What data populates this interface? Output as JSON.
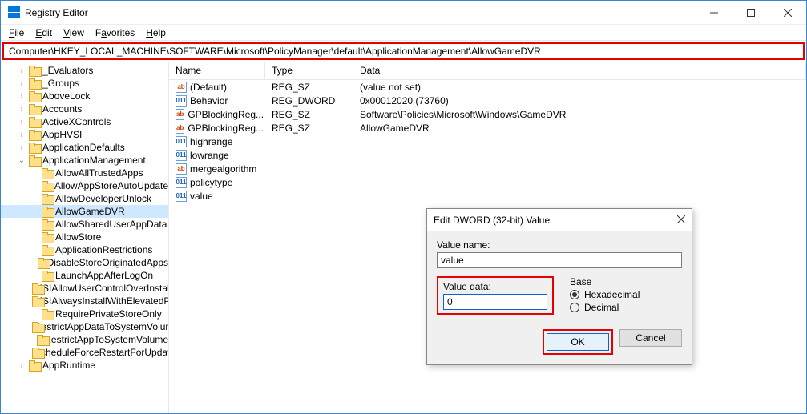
{
  "title": "Registry Editor",
  "window_controls": {
    "min": "minimize",
    "max": "maximize",
    "close": "close"
  },
  "menu": {
    "file": "File",
    "edit": "Edit",
    "view": "View",
    "favorites": "Favorites",
    "help": "Help"
  },
  "address": "Computer\\HKEY_LOCAL_MACHINE\\SOFTWARE\\Microsoft\\PolicyManager\\default\\ApplicationManagement\\AllowGameDVR",
  "tree": [
    {
      "label": "_Evaluators",
      "indent": 1,
      "exp": ">"
    },
    {
      "label": "_Groups",
      "indent": 1,
      "exp": ">"
    },
    {
      "label": "AboveLock",
      "indent": 1,
      "exp": ">"
    },
    {
      "label": "Accounts",
      "indent": 1,
      "exp": ">"
    },
    {
      "label": "ActiveXControls",
      "indent": 1,
      "exp": ">"
    },
    {
      "label": "AppHVSI",
      "indent": 1,
      "exp": ">"
    },
    {
      "label": "ApplicationDefaults",
      "indent": 1,
      "exp": ">"
    },
    {
      "label": "ApplicationManagement",
      "indent": 1,
      "exp": "v"
    },
    {
      "label": "AllowAllTrustedApps",
      "indent": 2,
      "exp": ""
    },
    {
      "label": "AllowAppStoreAutoUpdate",
      "indent": 2,
      "exp": ""
    },
    {
      "label": "AllowDeveloperUnlock",
      "indent": 2,
      "exp": ""
    },
    {
      "label": "AllowGameDVR",
      "indent": 2,
      "exp": "",
      "selected": true
    },
    {
      "label": "AllowSharedUserAppData",
      "indent": 2,
      "exp": ""
    },
    {
      "label": "AllowStore",
      "indent": 2,
      "exp": ""
    },
    {
      "label": "ApplicationRestrictions",
      "indent": 2,
      "exp": ""
    },
    {
      "label": "DisableStoreOriginatedApps",
      "indent": 2,
      "exp": ""
    },
    {
      "label": "LaunchAppAfterLogOn",
      "indent": 2,
      "exp": ""
    },
    {
      "label": "MSIAllowUserControlOverInstall",
      "indent": 2,
      "exp": ""
    },
    {
      "label": "MSIAlwaysInstallWithElevatedPrivileges",
      "indent": 2,
      "exp": ""
    },
    {
      "label": "RequirePrivateStoreOnly",
      "indent": 2,
      "exp": ""
    },
    {
      "label": "RestrictAppDataToSystemVolume",
      "indent": 2,
      "exp": ""
    },
    {
      "label": "RestrictAppToSystemVolume",
      "indent": 2,
      "exp": ""
    },
    {
      "label": "ScheduleForceRestartForUpdateFailures",
      "indent": 2,
      "exp": ""
    },
    {
      "label": "AppRuntime",
      "indent": 1,
      "exp": ">"
    }
  ],
  "columns": {
    "name": "Name",
    "type": "Type",
    "data": "Data"
  },
  "values": [
    {
      "icon": "sz",
      "name": "(Default)",
      "type": "REG_SZ",
      "data": "(value not set)"
    },
    {
      "icon": "dw",
      "name": "Behavior",
      "type": "REG_DWORD",
      "data": "0x00012020 (73760)"
    },
    {
      "icon": "sz",
      "name": "GPBlockingReg...",
      "type": "REG_SZ",
      "data": "Software\\Policies\\Microsoft\\Windows\\GameDVR"
    },
    {
      "icon": "sz",
      "name": "GPBlockingReg...",
      "type": "REG_SZ",
      "data": "AllowGameDVR"
    },
    {
      "icon": "dw",
      "name": "highrange",
      "type": "",
      "data": ""
    },
    {
      "icon": "dw",
      "name": "lowrange",
      "type": "",
      "data": ""
    },
    {
      "icon": "sz",
      "name": "mergealgorithm",
      "type": "",
      "data": ""
    },
    {
      "icon": "dw",
      "name": "policytype",
      "type": "",
      "data": ""
    },
    {
      "icon": "dw",
      "name": "value",
      "type": "",
      "data": ""
    }
  ],
  "dialog": {
    "title": "Edit DWORD (32-bit) Value",
    "value_name_label": "Value name:",
    "value_name": "value",
    "value_data_label": "Value data:",
    "value_data": "0",
    "base_label": "Base",
    "hex": "Hexadecimal",
    "dec": "Decimal",
    "base_selected": "hex",
    "ok": "OK",
    "cancel": "Cancel"
  }
}
